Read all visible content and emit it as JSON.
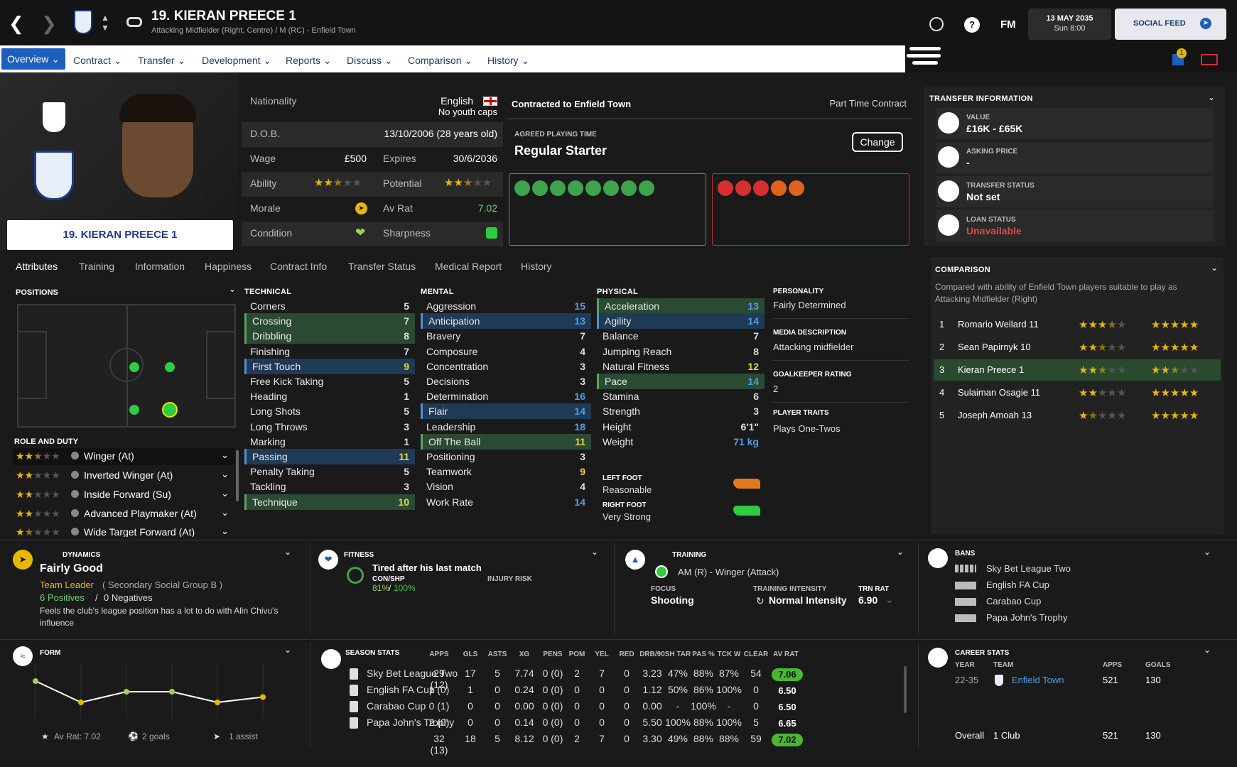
{
  "header": {
    "name": "19. KIERAN PREECE 1",
    "position": "Attacking Midfielder (Right, Centre) / M (RC) - Enfield Town",
    "date": "13 MAY 2035",
    "time": "Sun 8:00",
    "social_feed": "SOCIAL FEED",
    "fm": "FM",
    "help": "?"
  },
  "nav": {
    "tabs": [
      "Overview",
      "Contract",
      "Transfer",
      "Development",
      "Reports",
      "Discuss",
      "Comparison",
      "History"
    ],
    "notif_count": "1"
  },
  "profile": {
    "card_name": "19. KIERAN PREECE 1",
    "nationality_label": "Nationality",
    "nationality": "English",
    "youth_caps": "No youth caps",
    "dob_label": "D.O.B.",
    "dob": "13/10/2006 (28 years old)",
    "wage_label": "Wage",
    "wage": "£500",
    "expires_label": "Expires",
    "expires": "30/6/2036",
    "ability_label": "Ability",
    "potential_label": "Potential",
    "morale_label": "Morale",
    "avrat_label": "Av Rat",
    "avrat": "7.02",
    "condition_label": "Condition",
    "sharpness_label": "Sharpness"
  },
  "contract": {
    "club": "Contracted to Enfield Town",
    "type": "Part Time Contract",
    "agreed_label": "AGREED PLAYING TIME",
    "playing_time": "Regular Starter",
    "change": "Change"
  },
  "subtabs": [
    "Attributes",
    "Training",
    "Information",
    "Happiness",
    "Contract Info",
    "Transfer Status",
    "Medical Report",
    "History"
  ],
  "positions": {
    "title": "POSITIONS",
    "role_title": "ROLE AND DUTY",
    "roles": [
      {
        "name": "Winger (At)",
        "stars": 2.5
      },
      {
        "name": "Inverted Winger (At)",
        "stars": 2
      },
      {
        "name": "Inside Forward (Su)",
        "stars": 2
      },
      {
        "name": "Advanced Playmaker (At)",
        "stars": 2
      },
      {
        "name": "Wide Target Forward (At)",
        "stars": 1.5
      }
    ]
  },
  "technical": {
    "title": "TECHNICAL",
    "items": [
      [
        "Corners",
        "5"
      ],
      [
        "Crossing",
        "7"
      ],
      [
        "Dribbling",
        "8"
      ],
      [
        "Finishing",
        "7"
      ],
      [
        "First Touch",
        "9"
      ],
      [
        "Free Kick Taking",
        "5"
      ],
      [
        "Heading",
        "1"
      ],
      [
        "Long Shots",
        "5"
      ],
      [
        "Long Throws",
        "3"
      ],
      [
        "Marking",
        "1"
      ],
      [
        "Passing",
        "11"
      ],
      [
        "Penalty Taking",
        "5"
      ],
      [
        "Tackling",
        "3"
      ],
      [
        "Technique",
        "10"
      ]
    ]
  },
  "mental": {
    "title": "MENTAL",
    "items": [
      [
        "Aggression",
        "15"
      ],
      [
        "Anticipation",
        "13"
      ],
      [
        "Bravery",
        "7"
      ],
      [
        "Composure",
        "4"
      ],
      [
        "Concentration",
        "3"
      ],
      [
        "Decisions",
        "3"
      ],
      [
        "Determination",
        "16"
      ],
      [
        "Flair",
        "14"
      ],
      [
        "Leadership",
        "18"
      ],
      [
        "Off The Ball",
        "11"
      ],
      [
        "Positioning",
        "3"
      ],
      [
        "Teamwork",
        "9"
      ],
      [
        "Vision",
        "4"
      ],
      [
        "Work Rate",
        "14"
      ]
    ]
  },
  "physical": {
    "title": "PHYSICAL",
    "items": [
      [
        "Acceleration",
        "13"
      ],
      [
        "Agility",
        "14"
      ],
      [
        "Balance",
        "7"
      ],
      [
        "Jumping Reach",
        "8"
      ],
      [
        "Natural Fitness",
        "12"
      ],
      [
        "Pace",
        "14"
      ],
      [
        "Stamina",
        "6"
      ],
      [
        "Strength",
        "3"
      ],
      [
        "Height",
        "6'1\""
      ],
      [
        "Weight",
        "71 kg"
      ]
    ],
    "left_foot_label": "LEFT FOOT",
    "left_foot": "Reasonable",
    "right_foot_label": "RIGHT FOOT",
    "right_foot": "Very Strong"
  },
  "personality": {
    "p_label": "PERSONALITY",
    "p": "Fairly Determined",
    "m_label": "MEDIA DESCRIPTION",
    "m": "Attacking midfielder",
    "g_label": "GOALKEEPER RATING",
    "g": "2",
    "t_label": "PLAYER TRAITS",
    "t": "Plays One-Twos"
  },
  "transfer": {
    "title": "TRANSFER INFORMATION",
    "value_label": "VALUE",
    "value": "£16K - £65K",
    "asking_label": "ASKING PRICE",
    "asking": "-",
    "status_label": "TRANSFER STATUS",
    "status": "Not set",
    "loan_label": "LOAN STATUS",
    "loan": "Unavailable"
  },
  "comparison": {
    "title": "COMPARISON",
    "desc": "Compared with ability of Enfield Town players suitable to play as Attacking Midfielder (Right)",
    "rows": [
      {
        "rank": "1",
        "name": "Romario Wellard 11",
        "ca": 3.5,
        "pa": 5
      },
      {
        "rank": "2",
        "name": "Sean Papirnyk 10",
        "ca": 2.5,
        "pa": 5
      },
      {
        "rank": "3",
        "name": "Kieran Preece 1",
        "ca": 2.5,
        "pa": 2.5
      },
      {
        "rank": "4",
        "name": "Sulaiman Osagie 11",
        "ca": 2,
        "pa": 5
      },
      {
        "rank": "5",
        "name": "Joseph Amoah 13",
        "ca": 1.5,
        "pa": 5
      }
    ]
  },
  "dynamics": {
    "title": "DYNAMICS",
    "status": "Fairly Good",
    "leader": "Team Leader",
    "group": "( Secondary Social Group B )",
    "positives": "6 Positives",
    "negatives": "0 Negatives",
    "note": "Feels the club's league position has a lot to do with Alin Chivu's influence"
  },
  "fitness": {
    "title": "FITNESS",
    "status": "Tired after his last match",
    "con_label": "CON/SHP",
    "con": "81%",
    "shp": "100%",
    "injury_label": "INJURY RISK"
  },
  "training": {
    "title": "TRAINING",
    "role": "AM (R) - Winger (Attack)",
    "focus_label": "FOCUS",
    "focus": "Shooting",
    "intensity_label": "TRAINING INTENSITY",
    "intensity": "Normal Intensity",
    "trn_label": "TRN RAT",
    "trn": "6.90"
  },
  "bans": {
    "title": "BANS",
    "comps": [
      "Sky Bet League Two",
      "English FA Cup",
      "Carabao Cup",
      "Papa John's Trophy"
    ]
  },
  "form": {
    "title": "FORM",
    "avrat": "Av Rat: 7.02",
    "goals": "2 goals",
    "assists": "1 assist",
    "values": [
      7.1,
      6.9,
      7.0,
      7.0,
      6.9,
      6.95
    ]
  },
  "season": {
    "title": "SEASON STATS",
    "cols": [
      "APPS",
      "GLS",
      "ASTS",
      "XG",
      "PENS",
      "POM",
      "YEL",
      "RED",
      "DRB/90",
      "SH TAR",
      "PAS %",
      "TCK W",
      "CLEAR",
      "AV RAT"
    ],
    "rows": [
      {
        "comp": "Sky Bet League Two",
        "v": [
          "29 (12)",
          "17",
          "5",
          "7.74",
          "0 (0)",
          "2",
          "7",
          "0",
          "3.23",
          "47%",
          "88%",
          "87%",
          "54"
        ],
        "rat": "7.06",
        "good": true
      },
      {
        "comp": "English FA Cup",
        "v": [
          "1 (0)",
          "1",
          "0",
          "0.24",
          "0 (0)",
          "0",
          "0",
          "0",
          "1.12",
          "50%",
          "86%",
          "100%",
          "0"
        ],
        "rat": "6.50",
        "good": false
      },
      {
        "comp": "Carabao Cup",
        "v": [
          "0 (1)",
          "0",
          "0",
          "0.00",
          "0 (0)",
          "0",
          "0",
          "0",
          "0.00",
          "-",
          "100%",
          "-",
          "0"
        ],
        "rat": "6.50",
        "good": false
      },
      {
        "comp": "Papa John's Trophy",
        "v": [
          "2 (0)",
          "0",
          "0",
          "0.14",
          "0 (0)",
          "0",
          "0",
          "0",
          "5.50",
          "100%",
          "88%",
          "100%",
          "5"
        ],
        "rat": "6.65",
        "good": false
      },
      {
        "comp": "",
        "v": [
          "32 (13)",
          "18",
          "5",
          "8.12",
          "0 (0)",
          "2",
          "7",
          "0",
          "3.30",
          "49%",
          "88%",
          "88%",
          "59"
        ],
        "rat": "7.02",
        "good": true
      }
    ]
  },
  "career": {
    "title": "CAREER STATS",
    "year_label": "YEAR",
    "team_label": "TEAM",
    "apps_label": "APPS",
    "goals_label": "GOALS",
    "year": "22-35",
    "team": "Enfield Town",
    "apps": "521",
    "goals": "130",
    "overall": "Overall",
    "overall_clubs": "1 Club",
    "overall_apps": "521",
    "overall_goals": "130"
  },
  "colors": {
    "accent": "#1d5fbf",
    "green": "#5fa05f",
    "blue": "#4f8fd0",
    "yellow": "#e6b800",
    "red": "#e04040"
  }
}
